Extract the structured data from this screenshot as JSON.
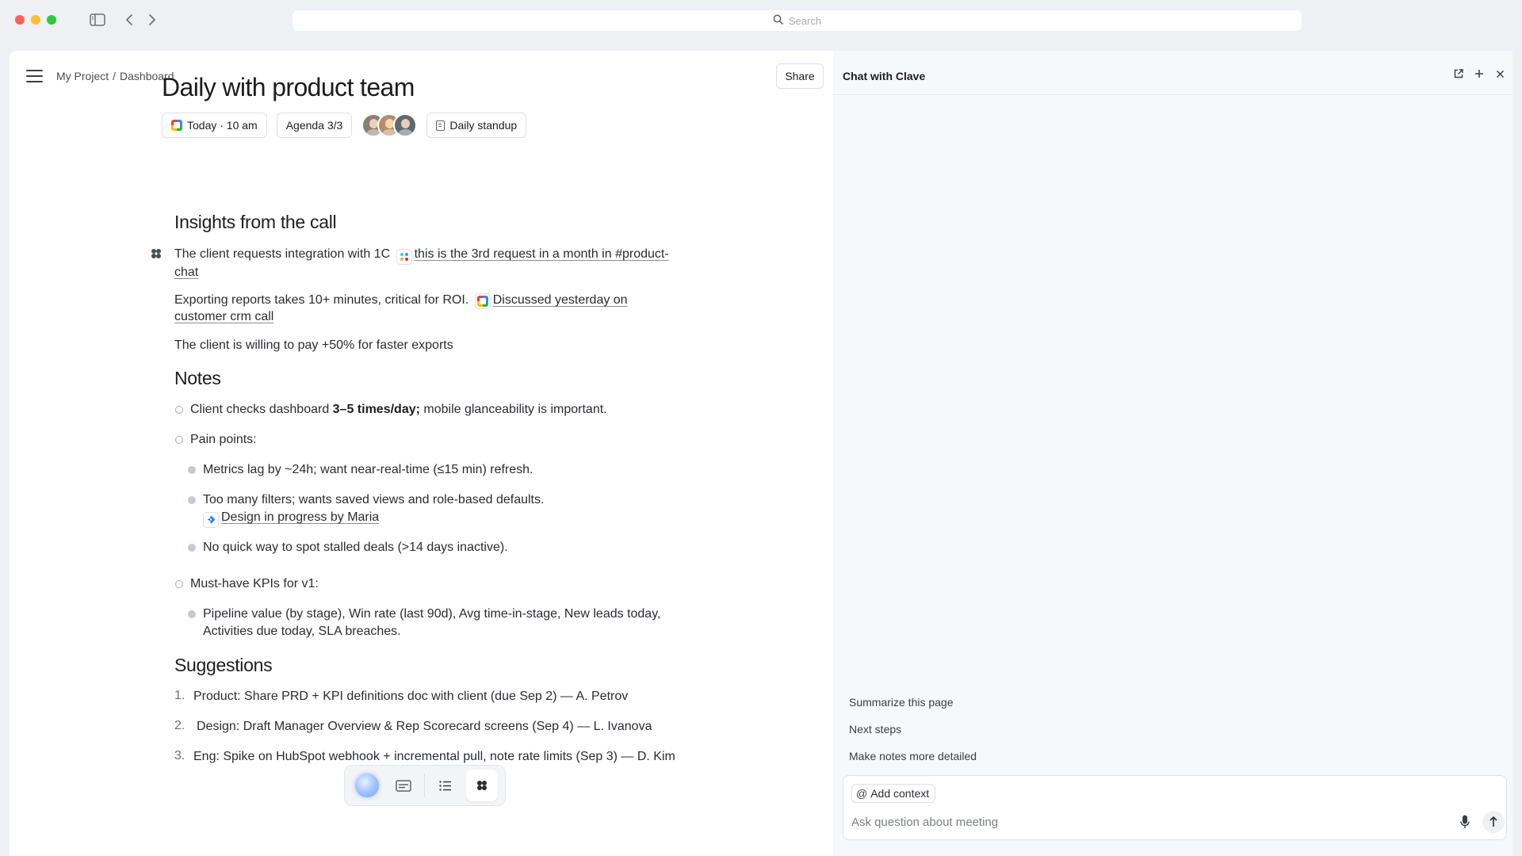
{
  "search": {
    "placeholder": "Search"
  },
  "breadcrumb": {
    "project": "My Project",
    "separator": "/",
    "page": "Dashboard"
  },
  "header": {
    "share_label": "Share"
  },
  "doc": {
    "title": "Daily with product team",
    "chips": {
      "date": "Today · 10 am",
      "agenda": "Agenda 3/3",
      "template": "Daily standup"
    },
    "insights": {
      "heading": "Insights from the call",
      "p1_text": "The client requests integration with 1C",
      "p1_link": "this is the 3rd request in a month in #product-chat",
      "p2_text": "Exporting reports takes 10+ minutes, critical for ROI.",
      "p2_link": "Discussed yesterday on customer crm call",
      "p3_text": "The client is willing to pay +50% for faster exports"
    },
    "notes": {
      "heading": "Notes",
      "n1_pre": "Client checks dashboard ",
      "n1_bold": "3–5 times/day;",
      "n1_post": " mobile glanceability is important.",
      "n2": "Pain points:",
      "n2a": "Metrics lag by ~24h; want near-real-time (≤15 min) refresh.",
      "n2b": "Too many filters; wants saved views and role-based defaults.",
      "n2b_link": "Design in progress by Maria",
      "n2c": "No quick way to spot stalled deals (>14 days inactive).",
      "n3": "Must-have KPIs for v1:",
      "n3a": "Pipeline value (by stage), Win rate (last 90d), Avg time-in-stage, New leads today, Activities due today, SLA breaches."
    },
    "suggestions": {
      "heading": "Suggestions",
      "items": [
        {
          "num": "1.",
          "text": "Product: Share PRD + KPI definitions doc with client (due Sep 2) — A. Petrov"
        },
        {
          "num": "2.",
          "text": "Design: Draft Manager Overview & Rep Scorecard screens (Sep 4) — L. Ivanova"
        },
        {
          "num": "3.",
          "text": "Eng: Spike on HubSpot webhook + incremental pull, note rate limits (Sep 3) — D. Kim"
        }
      ]
    }
  },
  "chat": {
    "title": "Chat with Clave",
    "suggestions": [
      "Summarize this page",
      "Next steps",
      "Make notes more detailed"
    ],
    "add_context": "Add context",
    "input_placeholder": "Ask question about meeting"
  },
  "icons": {
    "toolbar": [
      "sidebar-toggle-icon",
      "back-chevron-icon",
      "forward-chevron-icon",
      "search-icon"
    ],
    "floatbar": [
      "ai-orb-icon",
      "captions-icon",
      "list-icon",
      "clover-icon"
    ],
    "chat_header": [
      "open-external-icon",
      "plus-icon",
      "close-icon"
    ]
  },
  "colors": {
    "background": "#eef0f3",
    "panel": "#f7f8f9",
    "accent_blue": "#6f9df5"
  }
}
